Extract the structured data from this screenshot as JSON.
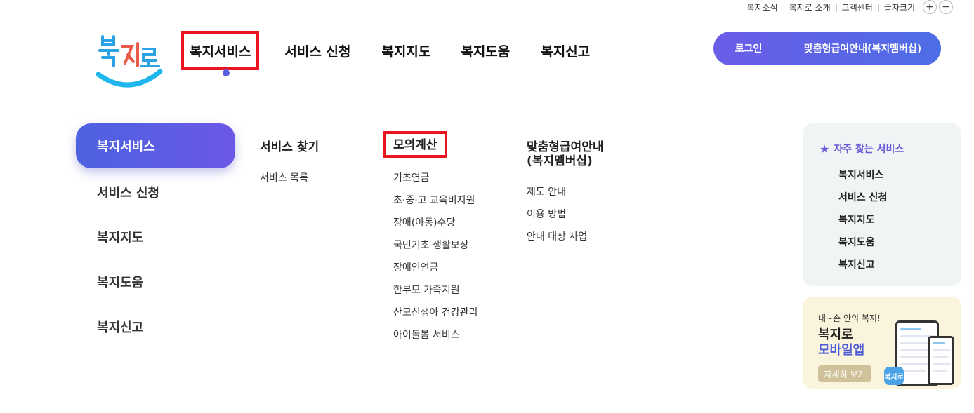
{
  "util": {
    "links": [
      "복지소식",
      "복지로 소개",
      "고객센터",
      "글자크기"
    ],
    "font_plus": "+",
    "font_minus": "−"
  },
  "logo": {
    "text": "복지로"
  },
  "gnb": {
    "items": [
      "복지서비스",
      "서비스 신청",
      "복지지도",
      "복지도움",
      "복지신고"
    ]
  },
  "auth": {
    "login": "로그인",
    "membership": "맞춤형급여안내(복지멤버십)"
  },
  "leftmenu": {
    "items": [
      "복지서비스",
      "서비스 신청",
      "복지지도",
      "복지도움",
      "복지신고"
    ]
  },
  "submenu": {
    "col1": {
      "title": "서비스 찾기",
      "items": [
        "서비스 목록"
      ]
    },
    "col2": {
      "title": "모의계산",
      "items": [
        "기초연금",
        "초·중·고 교육비지원",
        "장애(아동)수당",
        "국민기초 생활보장",
        "장애인연금",
        "한부모 가족지원",
        "산모신생아 건강관리",
        "아이돌봄 서비스"
      ]
    },
    "col3": {
      "title_line1": "맞춤형급여안내",
      "title_line2": "(복지멤버십)",
      "items": [
        "제도 안내",
        "이용 방법",
        "안내 대상 사업"
      ]
    }
  },
  "favorites": {
    "title": "자주 찾는 서비스",
    "items": [
      "복지서비스",
      "서비스 신청",
      "복지지도",
      "복지도움",
      "복지신고"
    ]
  },
  "app_banner": {
    "subtitle": "내~손 안의 복지!",
    "title1": "복지로",
    "title2": "모바일앱",
    "button": "자세히 보기",
    "icon_text": "복지로"
  },
  "colors": {
    "highlight_red": "#e8141f",
    "accent_purple": "#6a58d8",
    "accent_blue": "#4d62e0"
  }
}
